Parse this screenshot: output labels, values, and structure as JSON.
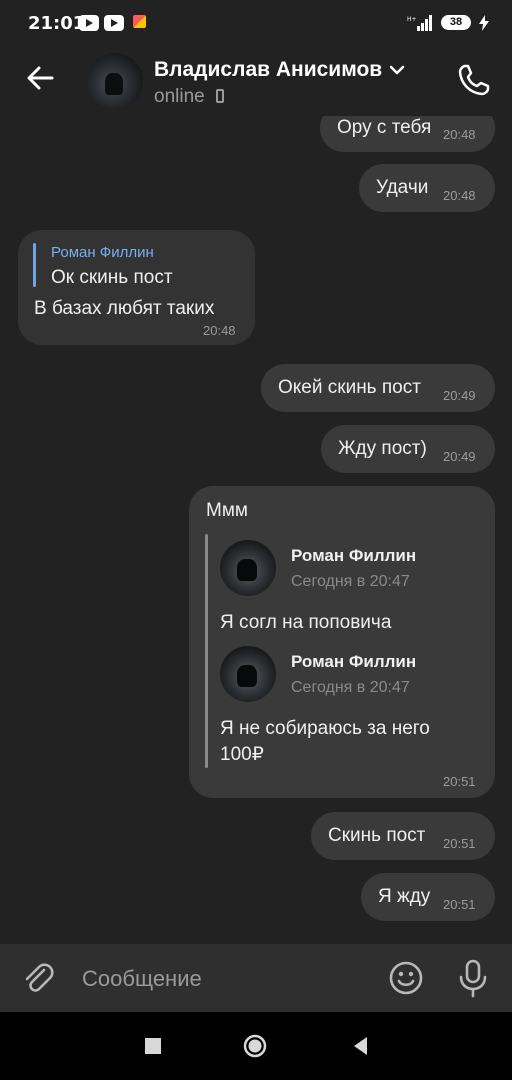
{
  "status_bar": {
    "time": "21:01",
    "battery": "38"
  },
  "header": {
    "contact_name": "Владислав Анисимов",
    "status": "online"
  },
  "messages": [
    {
      "text": "Ору с тебя",
      "time": "20:48"
    },
    {
      "text": "Удачи",
      "time": "20:48"
    },
    {
      "reply_author": "Роман Филлин",
      "reply_text": "Ок скинь пост",
      "text": "В базах любят таких",
      "time": "20:48"
    },
    {
      "text": "Окей скинь пост",
      "time": "20:49"
    },
    {
      "text": "Жду пост)",
      "time": "20:49"
    },
    {
      "text": "Ммм",
      "time": "20:51",
      "forwarded": [
        {
          "author": "Роман Филлин",
          "date": "Сегодня в 20:47",
          "text": "Я согл на поповича"
        },
        {
          "author": "Роман Филлин",
          "date": "Сегодня в 20:47",
          "text": "Я не собираюсь за него 100₽"
        }
      ]
    },
    {
      "text": "Скинь пост",
      "time": "20:51"
    },
    {
      "text": "Я жду",
      "time": "20:51"
    }
  ],
  "composer": {
    "placeholder": "Сообщение"
  },
  "icons": [
    "back-arrow-icon",
    "chevron-down-icon",
    "phone-icon",
    "paperclip-icon",
    "smiley-icon",
    "microphone-icon",
    "square-icon",
    "circle-icon",
    "triangle-icon"
  ],
  "colors": {
    "background": "#222222",
    "bubble": "#3a3a3a",
    "reply_accent": "#6fa3e8",
    "composer": "#2f2f2f"
  }
}
